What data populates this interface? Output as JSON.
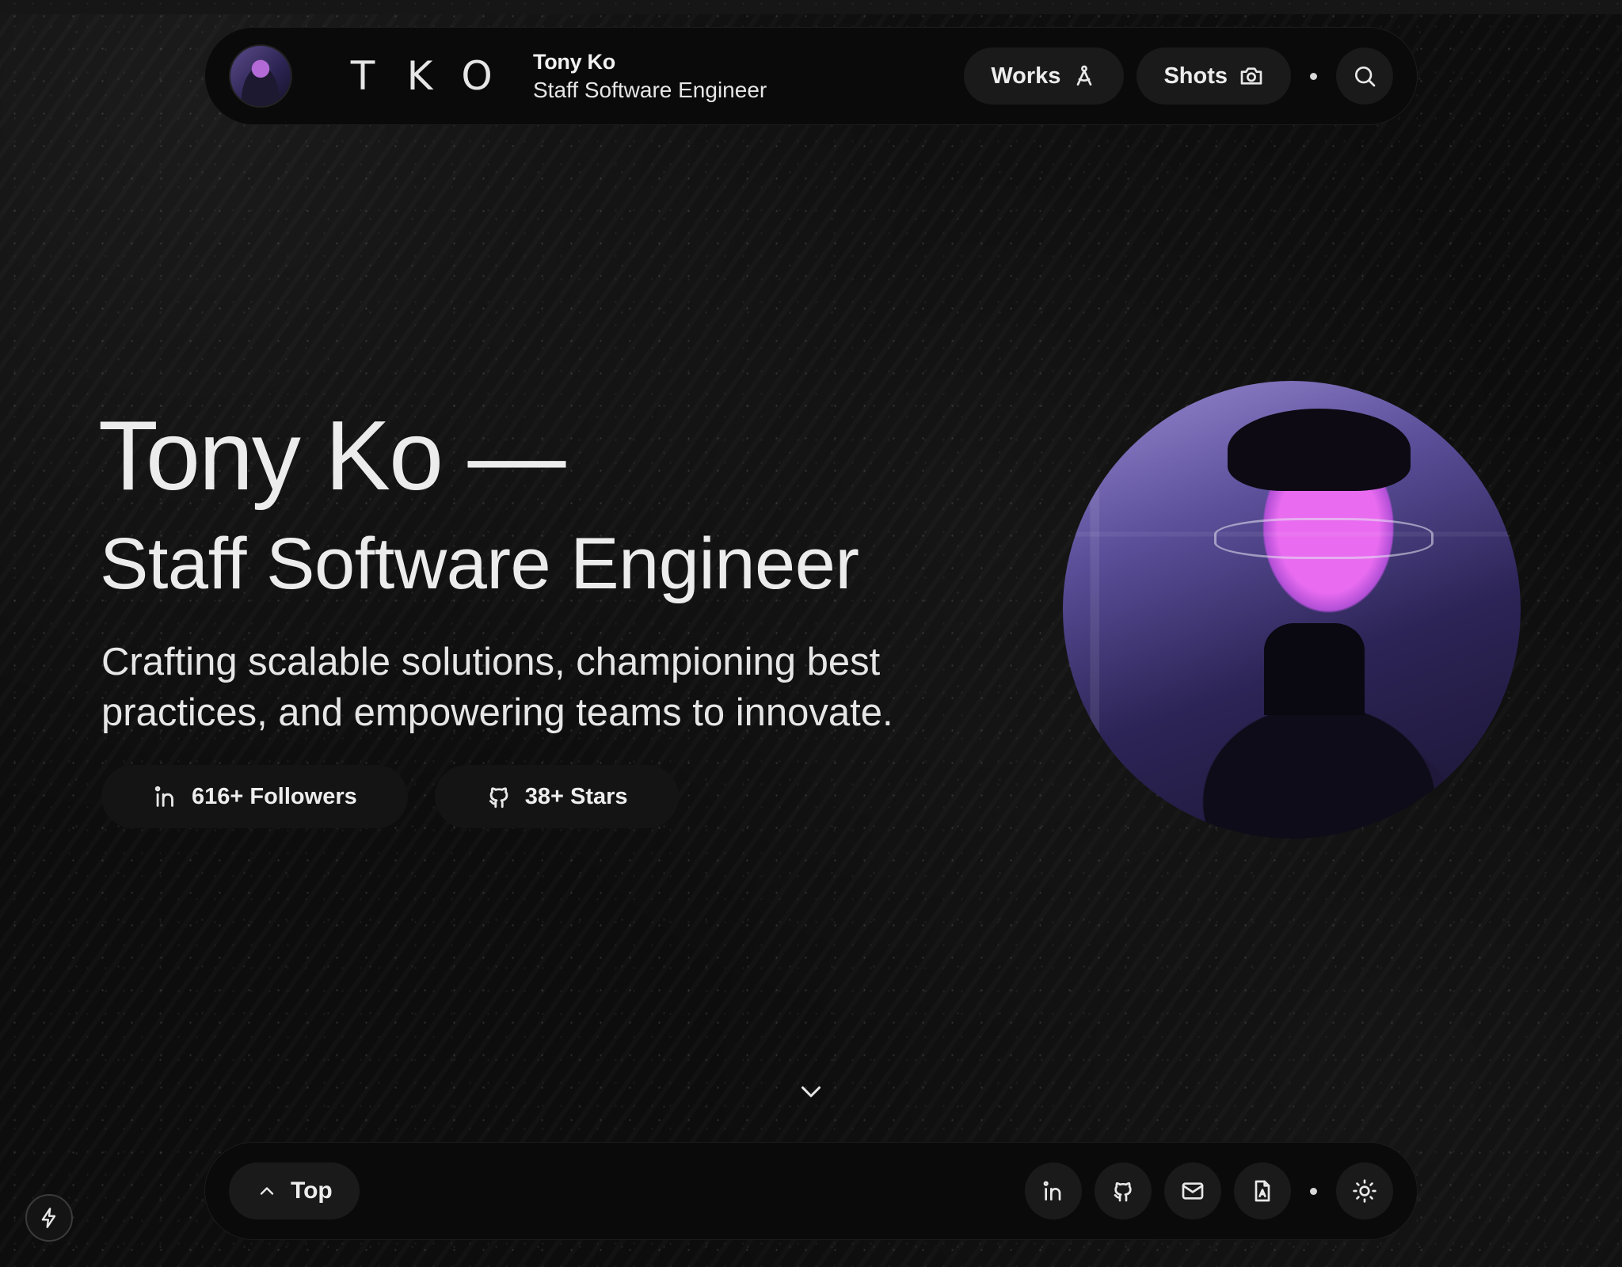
{
  "header": {
    "logo_letters": [
      "T",
      "K",
      "O"
    ],
    "name": "Tony Ko",
    "role": "Staff Software Engineer",
    "nav": [
      {
        "label": "Works",
        "icon": "compass-drafting-icon"
      },
      {
        "label": "Shots",
        "icon": "camera-icon"
      }
    ],
    "search_icon": "search-icon"
  },
  "hero": {
    "title": "Tony Ko —",
    "role": "Staff Software Engineer",
    "tagline": "Crafting scalable solutions, championing best practices, and empowering teams to innovate.",
    "stats": [
      {
        "label": "616+ Followers",
        "icon": "linkedin-icon"
      },
      {
        "label": "38+ Stars",
        "icon": "github-icon"
      }
    ]
  },
  "dock": {
    "top_label": "Top",
    "social_icons": [
      "linkedin-icon",
      "github-icon",
      "mail-icon",
      "resume-file-icon"
    ],
    "theme_icon": "sun-icon"
  },
  "colors": {
    "background": "#0d0d0d",
    "surface": "#0a0a0a",
    "pill": "#1a1a1a",
    "text": "#ededed",
    "portrait_accent": "#e96cf0"
  }
}
